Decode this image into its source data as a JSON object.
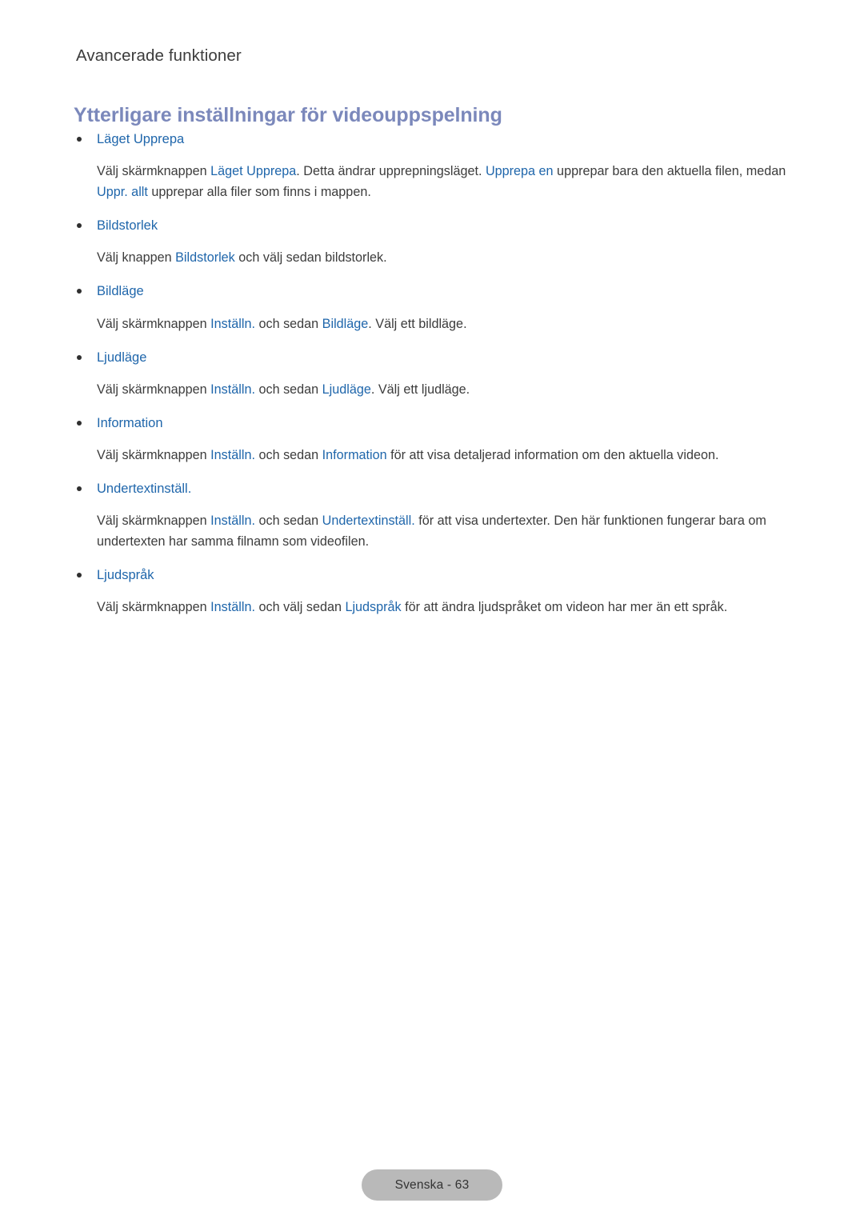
{
  "breadcrumb": "Avancerade funktioner",
  "section_heading": "Ytterligare inställningar för videouppspelning",
  "colors": {
    "heading": "#7b88bb",
    "link": "#1f66ab",
    "body_text": "#3c3c3c",
    "bullet_dot": "#2f2f2f",
    "footer_pill_bg": "#b9b9b9",
    "page_bg": "#ffffff"
  },
  "bullets": [
    {
      "title": "Läget Upprepa",
      "body_parts": [
        {
          "text": "Välj skärmknappen ",
          "link": false
        },
        {
          "text": "Läget Upprepa",
          "link": true
        },
        {
          "text": ". Detta ändrar upprepningsläget. ",
          "link": false
        },
        {
          "text": "Upprepa en",
          "link": true
        },
        {
          "text": " upprepar bara den aktuella filen, medan ",
          "link": false
        },
        {
          "text": "Uppr. allt",
          "link": true
        },
        {
          "text": " upprepar alla filer som finns i mappen.",
          "link": false
        }
      ]
    },
    {
      "title": "Bildstorlek",
      "body_parts": [
        {
          "text": "Välj knappen ",
          "link": false
        },
        {
          "text": "Bildstorlek",
          "link": true
        },
        {
          "text": " och välj sedan bildstorlek.",
          "link": false
        }
      ]
    },
    {
      "title": "Bildläge",
      "body_parts": [
        {
          "text": "Välj skärmknappen ",
          "link": false
        },
        {
          "text": "Inställn.",
          "link": true
        },
        {
          "text": " och sedan ",
          "link": false
        },
        {
          "text": "Bildläge",
          "link": true
        },
        {
          "text": ". Välj ett bildläge.",
          "link": false
        }
      ]
    },
    {
      "title": "Ljudläge",
      "body_parts": [
        {
          "text": "Välj skärmknappen ",
          "link": false
        },
        {
          "text": "Inställn.",
          "link": true
        },
        {
          "text": " och sedan ",
          "link": false
        },
        {
          "text": "Ljudläge",
          "link": true
        },
        {
          "text": ". Välj ett ljudläge.",
          "link": false
        }
      ]
    },
    {
      "title": "Information",
      "body_parts": [
        {
          "text": "Välj skärmknappen ",
          "link": false
        },
        {
          "text": "Inställn.",
          "link": true
        },
        {
          "text": " och sedan ",
          "link": false
        },
        {
          "text": "Information",
          "link": true
        },
        {
          "text": " för att visa detaljerad information om den aktuella videon.",
          "link": false
        }
      ]
    },
    {
      "title": "Undertextinställ.",
      "body_parts": [
        {
          "text": "Välj skärmknappen ",
          "link": false
        },
        {
          "text": "Inställn.",
          "link": true
        },
        {
          "text": " och sedan ",
          "link": false
        },
        {
          "text": "Undertextinställ.",
          "link": true
        },
        {
          "text": " för att visa undertexter. Den här funktionen fungerar bara om undertexten har samma filnamn som videofilen.",
          "link": false
        }
      ]
    },
    {
      "title": "Ljudspråk",
      "body_parts": [
        {
          "text": "Välj skärmknappen ",
          "link": false
        },
        {
          "text": "Inställn.",
          "link": true
        },
        {
          "text": " och välj sedan ",
          "link": false
        },
        {
          "text": "Ljudspråk",
          "link": true
        },
        {
          "text": " för att ändra ljudspråket om videon har mer än ett språk.",
          "link": false
        }
      ]
    }
  ],
  "footer": {
    "page_label": "Svenska - 63"
  }
}
